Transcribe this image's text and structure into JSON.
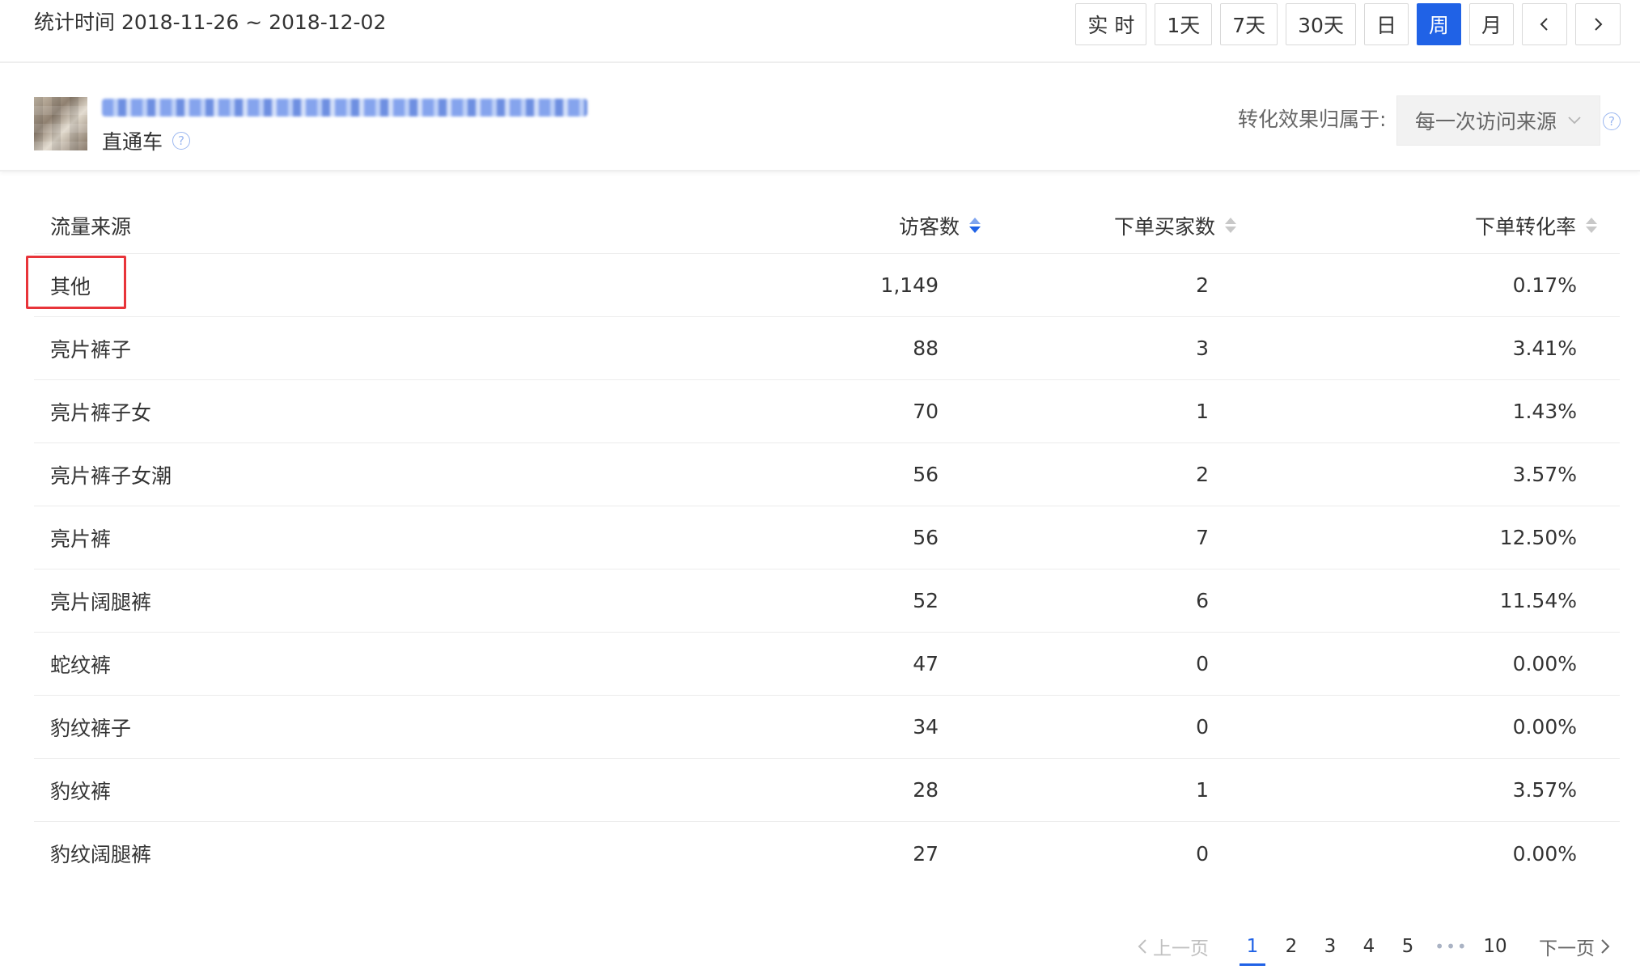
{
  "header": {
    "stat_time": "统计时间 2018-11-26 ~ 2018-12-02",
    "time_buttons": [
      {
        "label": "实 时",
        "active": false
      },
      {
        "label": "1天",
        "active": false
      },
      {
        "label": "7天",
        "active": false
      },
      {
        "label": "30天",
        "active": false
      },
      {
        "label": "日",
        "active": false
      },
      {
        "label": "周",
        "active": true
      },
      {
        "label": "月",
        "active": false
      }
    ],
    "prev_icon": "chevron-left-icon",
    "next_icon": "chevron-right-icon"
  },
  "item": {
    "channel": "直通车",
    "attribution_label": "转化效果归属于:",
    "attribution_value": "每一次访问来源"
  },
  "table": {
    "columns": {
      "source": "流量来源",
      "visitors": "访客数",
      "buyers": "下单买家数",
      "rate": "下单转化率"
    },
    "rows": [
      {
        "source": "其他",
        "visitors": "1,149",
        "buyers": "2",
        "rate": "0.17%"
      },
      {
        "source": "亮片裤子",
        "visitors": "88",
        "buyers": "3",
        "rate": "3.41%"
      },
      {
        "source": "亮片裤子女",
        "visitors": "70",
        "buyers": "1",
        "rate": "1.43%"
      },
      {
        "source": "亮片裤子女潮",
        "visitors": "56",
        "buyers": "2",
        "rate": "3.57%"
      },
      {
        "source": "亮片裤",
        "visitors": "56",
        "buyers": "7",
        "rate": "12.50%"
      },
      {
        "source": "亮片阔腿裤",
        "visitors": "52",
        "buyers": "6",
        "rate": "11.54%"
      },
      {
        "source": "蛇纹裤",
        "visitors": "47",
        "buyers": "0",
        "rate": "0.00%"
      },
      {
        "source": "豹纹裤子",
        "visitors": "34",
        "buyers": "0",
        "rate": "0.00%"
      },
      {
        "source": "豹纹裤",
        "visitors": "28",
        "buyers": "1",
        "rate": "3.57%"
      },
      {
        "source": "豹纹阔腿裤",
        "visitors": "27",
        "buyers": "0",
        "rate": "0.00%"
      }
    ]
  },
  "pagination": {
    "prev": "上一页",
    "next": "下一页",
    "pages": [
      "1",
      "2",
      "3",
      "4",
      "5"
    ],
    "ellipsis": "•••",
    "last": "10",
    "current": "1"
  },
  "colors": {
    "accent": "#2062e6",
    "highlight": "#e8343a"
  }
}
